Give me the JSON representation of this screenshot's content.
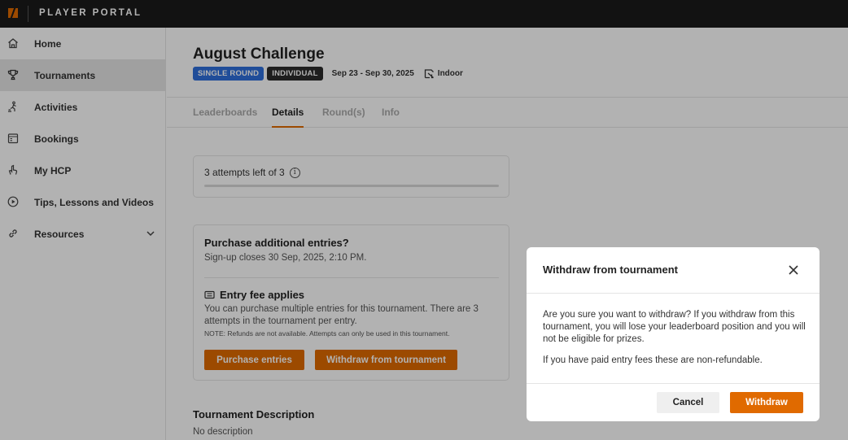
{
  "topbar": {
    "brand": "PLAYER PORTAL",
    "logo_color": "#e06a00"
  },
  "sidebar": {
    "items": [
      {
        "label": "Home",
        "icon": "home-icon"
      },
      {
        "label": "Tournaments",
        "icon": "trophy-icon",
        "active": true
      },
      {
        "label": "Activities",
        "icon": "activities-icon"
      },
      {
        "label": "Bookings",
        "icon": "calendar-icon"
      },
      {
        "label": "My HCP",
        "icon": "hand-icon"
      },
      {
        "label": "Tips, Lessons and Videos",
        "icon": "play-circle-icon"
      },
      {
        "label": "Resources",
        "icon": "link-icon",
        "expandable": true
      }
    ]
  },
  "tournament": {
    "title": "August Challenge",
    "badges": [
      "SINGLE ROUND",
      "INDIVIDUAL"
    ],
    "dates": "Sep 23 - Sep 30, 2025",
    "venue": "Indoor"
  },
  "tabs": [
    "Leaderboards",
    "Details",
    "Round(s)",
    "Info"
  ],
  "active_tab": "Details",
  "attempts": {
    "text": "3 attempts left of 3",
    "progress_fraction": 0
  },
  "purchase": {
    "title": "Purchase additional entries?",
    "subtitle": "Sign-up closes 30 Sep, 2025, 2:10 PM.",
    "fee_title": "Entry fee applies",
    "fee_desc": "You can purchase multiple entries for this tournament. There are 3 attempts in the tournament per entry.",
    "note": "NOTE: Refunds are not available. Attempts can only be used in this tournament.",
    "purchase_button": "Purchase entries",
    "withdraw_button": "Withdraw from tournament"
  },
  "description": {
    "title": "Tournament Description",
    "body": "No description"
  },
  "modal": {
    "title": "Withdraw from tournament",
    "paragraph1": "Are you sure you want to withdraw? If you withdraw from this tournament, you will lose your leaderboard position and you will not be eligible for prizes.",
    "paragraph2": "If you have paid entry fees these are non-refundable.",
    "cancel": "Cancel",
    "confirm": "Withdraw"
  },
  "colors": {
    "accent": "#e06a00",
    "badge_blue": "#2f6fdc",
    "badge_dark": "#2b2b2b",
    "topbar": "#1a1a1a"
  }
}
